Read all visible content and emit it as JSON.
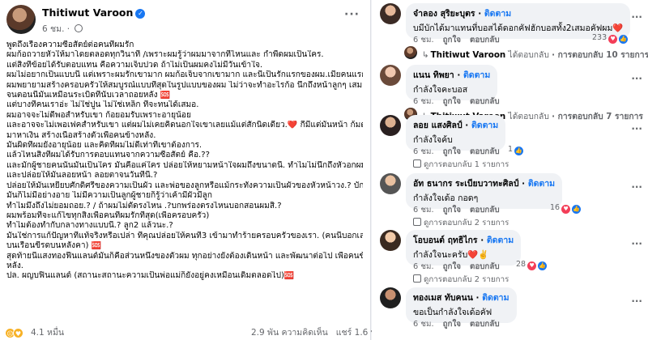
{
  "post": {
    "author": "Thitiwut Varoon",
    "time": "6 ชม.",
    "more_icon": "more-horizontal-icon",
    "lines": [
      "พูดถึงเรื่องความซื่อสัตย์ต่อคนที่ผมรัก",
      "ผมก้อถวายหัวให้มาโดยตลอดทุกวินาที /เพราะผมรู้ว่าผมมาจากที่ไหนและ กำพืดผมเป็นใคร.",
      "แต่สิ่งที่ข้อยได้รับตอบแทน คือความเจ็บปวด ถ้าไม่เป็นผมคงไม่มีวันเข้าใจ.",
      "ผมไม่อยากเป็นแบบนี้ แต่เพราะผมรักเขามาก ผมก้อเจ็บจากเขามาก และนี่เป็นรักแรกของผม.เมียคนแรก",
      "ผมพยายามสร้างครอบครัวให้สมบูรณ์แบบที่สุดในรูปแบบของผม ไม่ว่าจะทำอะไรก้อ นึกถึงหน้าลูกๆ เสมอ.",
      "จนตอนนี้มันเหมือนระเบิดที่นับเวลาถอยหลัง 🆘",
      "แต่บางทีคนเราอ่ะ ไม่ใช่ปูน ไม่ใช่เหล็ก ที่จะทนได้เสมอ.",
      "ผมอาจจะไม่ดีพอสำหรับเขา ก้อยอมรับเพราะอายุน้อย",
      "และอาจจะไม่เพอเฟคสำหรับเขา แต่ผมไม่เคยคิดนอกใจเขาเลยแม้แต่สักนิดเดียว.❤️ กี่มีแต่มั่นหน้า ก้มตาทำ",
      "มาหาเงิน สร้างเนื้อสร้างตัวเพื่อคนข้างหลัง.",
      "มันผิดที่ผมยังอายุน้อย และคิดที่ผมไม่ดีเท่าที่เขาต้องการ.",
      "แล้วไหนสิ่งที่ผมได้รับการตอบแทนจากความซื่อสัตย์ คือ.??",
      "และมักผู้ชายคนนั้นมันเป็นใคร มันคือแค่ใคร ปล่อยให้หยามหน้าใจผมถึงขนาดนี้. ทำไมไม่นึกถึงหัวอกผมบ้าง",
      "และปล่อยให้มันลอยหน้า ลอยตาจนวันที่นี้.?",
      "ปล่อยให้มันเหยียบศักดิ์ศรีของความเป็นผัว และพ่อของลูกหรือแม้กระทั่งความเป็นผัวของหัวหน้าวง.? บักผู้ชาย",
      "มันก็ไม่มีอย่างอาย ไม่มีความเป็นลูกผู้ชายก็รู้ว่าเค้ามีผัวมีลูก",
      "ทำไมมึงถึงไม่ยอมถอย.? / ถ้าผมไม่ตัดรงไหน .?บกพร่องตรงไหนบอกสอนผมสิ.?",
      "ผมพร้อมที่จะแก้ไขทุกสิ่งเพื่อคนที่ผมรักที่สุด(เพื่อครอบครัว)",
      "ทำไมต้องทำกับกลางทางแบบนี้.? ลูก2 แล้วนะ.?",
      "มันใช่การแก้ปัญหาที่แท้จริงหรือเปล่า ที่คุณปล่อยให้คนที่3 เข้ามาทำร้ายครอบครัวของเรา. (คนนี้บอกเลยกิน",
      "บนเรือนขี้รดบนหลังคา) 🆘",
      "สุดท้ายนี้แสงทองฟีนแลนด์มันก็คือส่วนหนึ่งของตัวผม ทุกอย่างยังต้องเดินหน้า และพัฒนาต่อไป เพื่อคนข้าง",
      "หลัง.",
      "ปล. ผญบฟินแลนด์ (สถานะสถานะความเป็นพ่อแม่ก็ยังอยู่คงเหมือนเดิมตลอดไป)🆘"
    ],
    "reactions": "4.1 หมื่น",
    "comments_count": "2.9 พัน ความคิดเห็น",
    "shares_count": "แชร์ 1.6 พัน ครั้ง"
  },
  "comments": [
    {
      "name": "จ๋าลอง สุริยะบุตร",
      "follow": "ติดตาม",
      "text": "บมีบักได้มาแทนที่บอสได้ดอกคัฟฮักบอสทั้ง2เสมอคัฟผม❤️",
      "time": "6 ชม.",
      "like": "ถูกใจ",
      "reply": "ตอบกลับ",
      "count": "233",
      "reply_row": {
        "name": "Thitiwut Varoon",
        "action": "ได้ตอบกลับ",
        "replies": "· การตอบกลับ 10 รายการ",
        "count": "5"
      }
    },
    {
      "name": "แนน ทิพยา",
      "follow": "ติดตาม",
      "text": "กำลังใจคะบอส",
      "time": "6 ชม.",
      "like": "ถูกใจ",
      "reply": "ตอบกลับ",
      "count": "",
      "reply_row": {
        "name": "Thitiwut Varoon",
        "action": "ได้ตอบกลับ",
        "replies": "· การตอบกลับ 7 รายการ",
        "count": "5"
      }
    },
    {
      "name": "ลอย แสงศิลป์",
      "follow": "ติดตาม",
      "text": "กำลังใจค้บ",
      "time": "6 ชม.",
      "like": "ถูกใจ",
      "reply": "ตอบกลับ",
      "count": "1",
      "hidden": "ดูการตอบกลับ 1 รายการ"
    },
    {
      "name": "อัท ธนากร ระเบียบวาทะศิลป์",
      "follow": "ติดตาม",
      "text": "กำลังใจเด้อ กอดๆ",
      "time": "6 ชม.",
      "like": "ถูกใจ",
      "reply": "ตอบกลับ",
      "count": "16",
      "hidden": "ดูการตอบกลับ 2 รายการ"
    },
    {
      "name": "โอบอนต์ ฤทธิไกร",
      "follow": "ติดตาม",
      "text": "กำลังใจนะครับ❤️✌️",
      "time": "6 ชม.",
      "like": "ถูกใจ",
      "reply": "ตอบกลับ",
      "count": "28",
      "hidden": "ดูการตอบกลับ 2 รายการ"
    },
    {
      "name": "ทองเมส ทับคนน",
      "follow": "ติดตาม",
      "text": "ขอเป็นกำลังใจเด้อคัฟ",
      "time": "6 ชม.",
      "like": "ถูกใจ",
      "reply": "ตอบกลับ",
      "count": ""
    }
  ],
  "colors": {
    "accent": "#1877f2",
    "love": "#f33e58",
    "muted": "#65676b"
  }
}
